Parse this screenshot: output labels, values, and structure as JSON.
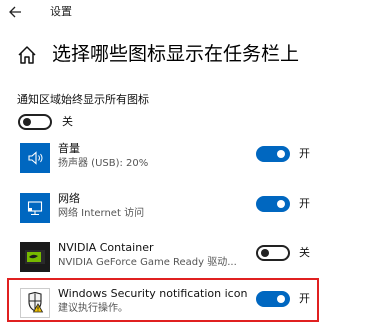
{
  "window": {
    "title": "设置"
  },
  "page": {
    "title": "选择哪些图标显示在任务栏上"
  },
  "always_show": {
    "label": "通知区域始终显示所有图标",
    "state_label": "关",
    "on": false
  },
  "apps": [
    {
      "name": "音量",
      "subtitle": "扬声器 (USB): 20%",
      "state_label": "开",
      "on": true,
      "icon": "speaker-icon"
    },
    {
      "name": "网络",
      "subtitle": "网络 Internet 访问",
      "state_label": "开",
      "on": true,
      "icon": "network-icon"
    },
    {
      "name": "NVIDIA Container",
      "subtitle": "NVIDIA GeForce Game Ready 驱动...",
      "state_label": "关",
      "on": false,
      "icon": "nvidia-icon"
    },
    {
      "name": "Windows Security notification icon",
      "subtitle": "建议执行操作。",
      "state_label": "开",
      "on": true,
      "icon": "shield-warning-icon"
    }
  ],
  "colors": {
    "accent": "#0067c0",
    "highlight": "#e02020"
  }
}
